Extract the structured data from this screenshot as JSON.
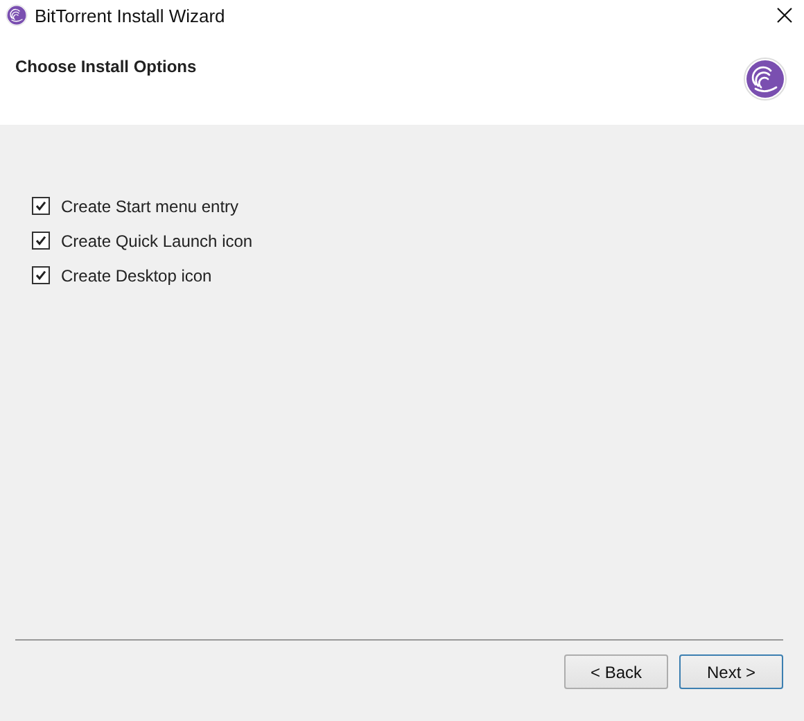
{
  "window": {
    "title": "BitTorrent Install Wizard"
  },
  "header": {
    "title": "Choose Install Options"
  },
  "options": [
    {
      "label": "Create Start menu entry",
      "checked": true
    },
    {
      "label": "Create Quick Launch icon",
      "checked": true
    },
    {
      "label": "Create Desktop icon",
      "checked": true
    }
  ],
  "buttons": [
    {
      "label": "< Back",
      "default": false
    },
    {
      "label": "Next >",
      "default": true
    }
  ]
}
